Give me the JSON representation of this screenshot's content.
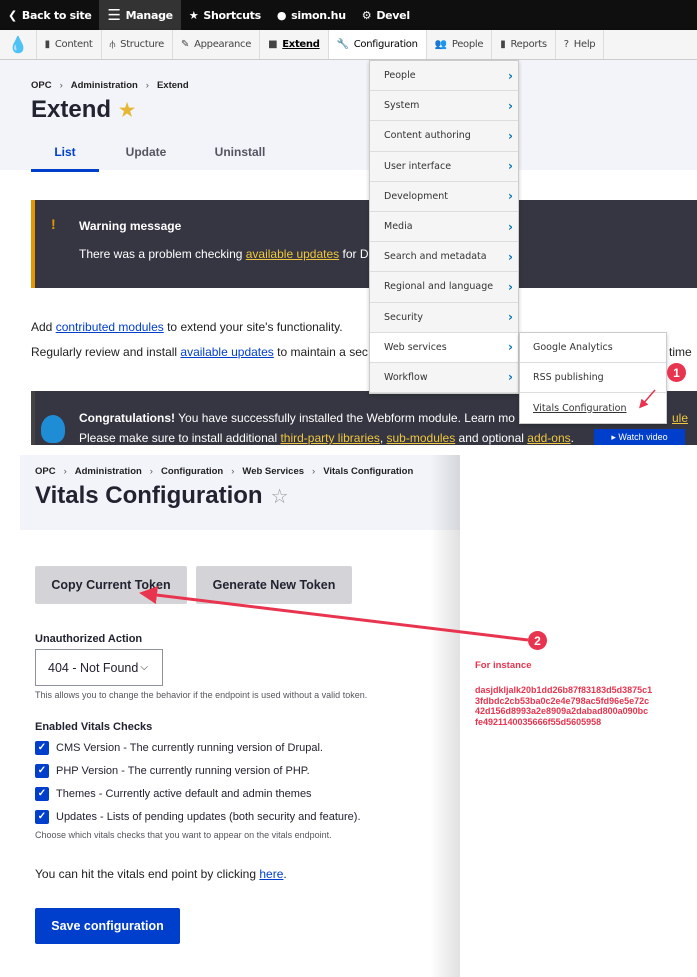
{
  "toolbar": {
    "back": "Back to site",
    "manage": "Manage",
    "shortcuts": "Shortcuts",
    "user": "simon.hu",
    "devel": "Devel"
  },
  "tray": {
    "content": "Content",
    "structure": "Structure",
    "appearance": "Appearance",
    "extend": "Extend",
    "configuration": "Configuration",
    "people": "People",
    "reports": "Reports",
    "help": "Help"
  },
  "extend_page": {
    "breadcrumb": [
      "OPC",
      "Administration",
      "Extend"
    ],
    "title": "Extend",
    "tabs": [
      "List",
      "Update",
      "Uninstall"
    ],
    "warning_title": "Warning message",
    "warning_pre": "There was a problem checking ",
    "warning_link": "available updates",
    "warning_post": " for D",
    "p1_pre": "Add ",
    "p1_link": "contributed modules",
    "p1_post": " to extend your site's functionality.",
    "p2_pre": "Regularly review and install ",
    "p2_link": "available updates",
    "p2_post": " to maintain a sec",
    "p2_tail": "time",
    "congrats_bold": "Congratulations!",
    "congrats_text": " You have successfully installed the Webform module. Learn mo",
    "congrats_tail": "ule ar",
    "congrats2_pre": "Please make sure to install additional ",
    "lib_link": "third-party libraries",
    "sub_link": "sub-modules",
    "and_optional": " and optional ",
    "addons_link": "add-ons",
    "watch": "▸ Watch video"
  },
  "config_menu": [
    "People",
    "System",
    "Content authoring",
    "User interface",
    "Development",
    "Media",
    "Search and metadata",
    "Regional and language",
    "Security",
    "Web services",
    "Workflow"
  ],
  "web_services_menu": [
    "Google Analytics",
    "RSS publishing",
    "Vitals Configuration"
  ],
  "vitals": {
    "breadcrumb": [
      "OPC",
      "Administration",
      "Configuration",
      "Web Services",
      "Vitals Configuration"
    ],
    "title": "Vitals Configuration",
    "copy_btn": "Copy Current Token",
    "generate_btn": "Generate New Token",
    "unauth_label": "Unauthorized Action",
    "unauth_value": "404 - Not Found",
    "unauth_desc": "This allows you to change the behavior if the endpoint is used without a valid token.",
    "checks_label": "Enabled Vitals Checks",
    "checks": [
      {
        "label": "CMS Version - The currently running version of Drupal.",
        "checked": true
      },
      {
        "label": "PHP Version - The currently running version of PHP.",
        "checked": true
      },
      {
        "label": "Themes - Currently active default and admin themes",
        "checked": true
      },
      {
        "label": "Updates - Lists of pending updates (both security and feature).",
        "checked": true
      }
    ],
    "checks_desc": "Choose which vitals checks that you want to appear on the vitals endpoint.",
    "hit_pre": "You can hit the vitals end point by clicking ",
    "hit_link": "here",
    "hit_post": ".",
    "save": "Save configuration"
  },
  "annotation": {
    "badge1": "1",
    "badge2": "2",
    "for_instance": "For instance",
    "token_lines": [
      "dasjdkljalk20b1dd26b87f83183d5d3875c1",
      "3fdbdc2cb53ba0c2e4e798ac5fd96e5e72c",
      "42d156d8993a2e8909a2dabad800a090bc",
      "fe4921140035666f55d5605958"
    ],
    "color": "#e8344e"
  },
  "colors": {
    "accent": "#003ecc",
    "warning": "#e29700",
    "message_bg": "#353641"
  }
}
